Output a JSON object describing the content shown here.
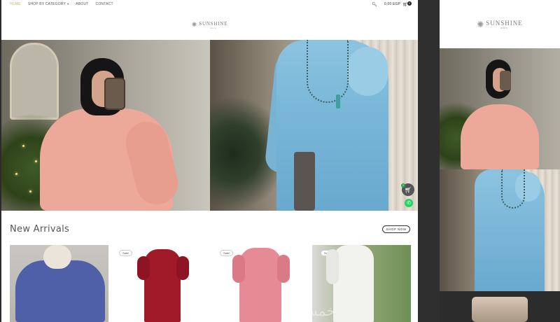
{
  "nav": {
    "items": [
      "HOME",
      "SHOP BY CATEGORY",
      "ABOUT",
      "CONTACT"
    ],
    "active": "HOME",
    "cart_total": "0,00 EGP",
    "cart_count": "0"
  },
  "brand": {
    "name": "SUNSHINE",
    "tagline": "store"
  },
  "floating": {
    "cart_badge": "0"
  },
  "section": {
    "title": "New Arrivals",
    "shop_now": "SHOP NOW"
  },
  "products": [
    {
      "badge": "",
      "color": "#4f5fa8"
    },
    {
      "badge": "Sale!",
      "color": "#a11a2a"
    },
    {
      "badge": "Sale!",
      "color": "#e68b96"
    },
    {
      "badge": "Sale!",
      "color": "#f2f2ef"
    }
  ],
  "watermark": "خمسات",
  "colors": {
    "nav_active": "#c7a98c",
    "whatsapp": "#25d366",
    "cart_badge": "#25a24a"
  },
  "icons": [
    "search-icon",
    "cart-icon",
    "whatsapp-icon"
  ]
}
